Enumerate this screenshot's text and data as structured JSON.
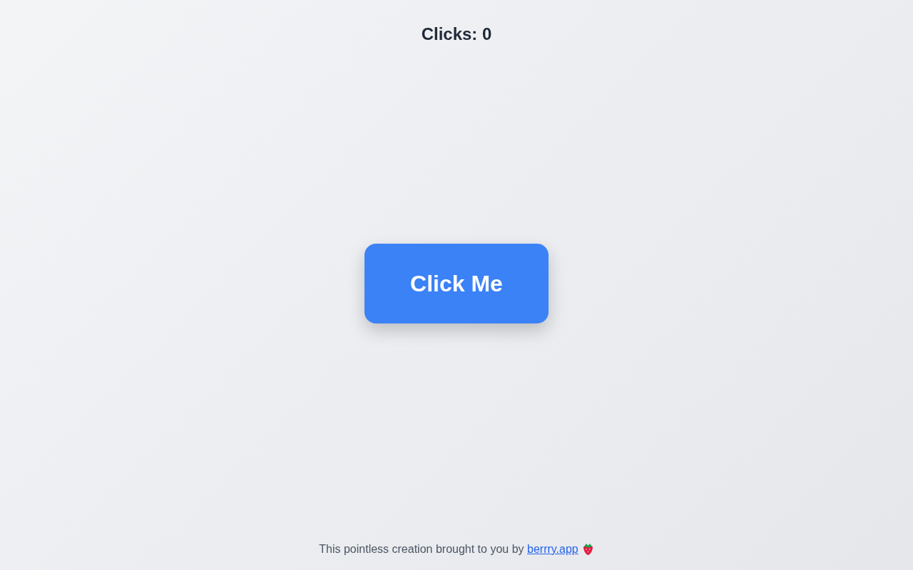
{
  "counter": {
    "label": "Clicks: 0"
  },
  "button": {
    "label": "Click Me"
  },
  "footer": {
    "text": "This pointless creation brought to you by",
    "link": "berrry.app"
  }
}
